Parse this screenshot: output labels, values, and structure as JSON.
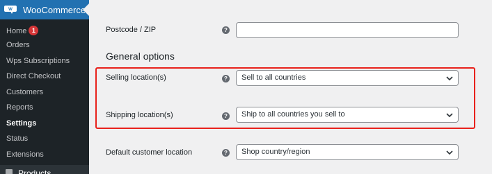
{
  "sidebar": {
    "title": "WooCommerce",
    "items": [
      {
        "label": "Home",
        "badge": "1"
      },
      {
        "label": "Orders"
      },
      {
        "label": "Wps Subscriptions"
      },
      {
        "label": "Direct Checkout"
      },
      {
        "label": "Customers"
      },
      {
        "label": "Reports"
      },
      {
        "label": "Settings",
        "active": true
      },
      {
        "label": "Status"
      },
      {
        "label": "Extensions"
      }
    ],
    "bottom_item": "Products"
  },
  "form": {
    "postcode": {
      "label": "Postcode / ZIP",
      "value": ""
    },
    "section_title": "General options",
    "selling": {
      "label": "Selling location(s)",
      "value": "Sell to all countries"
    },
    "shipping": {
      "label": "Shipping location(s)",
      "value": "Ship to all countries you sell to"
    },
    "default_location": {
      "label": "Default customer location",
      "value": "Shop country/region"
    },
    "help_glyph": "?"
  },
  "colors": {
    "sidebar_bg": "#1d2327",
    "sidebar_header": "#2271b1",
    "highlight": "#e8211b",
    "badge": "#d63638"
  }
}
